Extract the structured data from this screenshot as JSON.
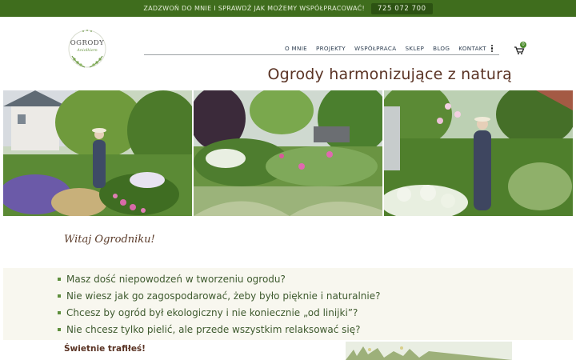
{
  "topbar": {
    "cta_text": "ZADZWOŃ DO MNIE I SPRAWDŹ JAK MOŻEMY WSPÓŁPRACOWAĆ!",
    "phone": "725 072 700"
  },
  "logo": {
    "name": "OGRODY",
    "subtitle": "Aniołkiem"
  },
  "nav": {
    "items": [
      "O MNIE",
      "PROJEKTY",
      "WSPÓŁPRACA",
      "SKLEP",
      "BLOG",
      "KONTAKT"
    ],
    "more_icon": "vertical-ellipsis-icon",
    "cart_icon": "cart-icon",
    "cart_count": "0"
  },
  "hero": {
    "headline": "Ogrody harmonizujące z naturą",
    "photos": [
      "garden-photo-1",
      "garden-photo-2",
      "garden-photo-3"
    ]
  },
  "intro": {
    "greeting": "Witaj Ogrodniku!",
    "questions": [
      "Masz dość niepowodzeń w tworzeniu ogrodu?",
      "Nie wiesz jak go zagospodarować, żeby było pięknie i naturalnie?",
      "Chcesz by ogród był ekologiczny i nie koniecznie „od linijki”?",
      "Nie chcesz tylko pielić, ale przede wszystkim relaksować się?"
    ],
    "answer": "Świetnie trafiłeś!"
  },
  "colors": {
    "topbar": "#3f6d1d",
    "brand_green": "#4a8a2a",
    "headline": "#5a3324",
    "bullet_text": "#3e5a2e"
  }
}
